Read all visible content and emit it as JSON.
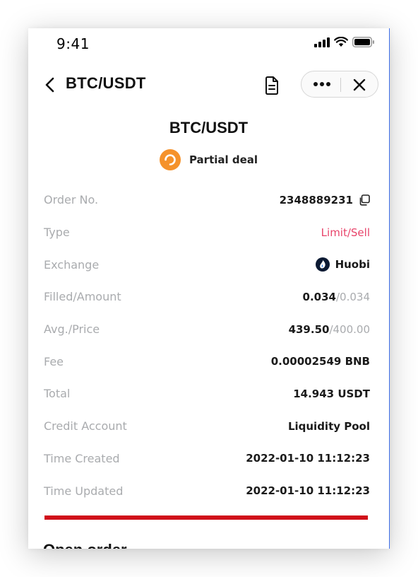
{
  "status_bar": {
    "time": "9:41"
  },
  "nav": {
    "title": "BTC/USDT"
  },
  "order": {
    "pair": "BTC/USDT",
    "status": "Partial deal",
    "status_color": "#f5922b",
    "rows": [
      {
        "label": "Order No.",
        "value": "2348889231"
      },
      {
        "label": "Type",
        "value": "Limit/Sell"
      },
      {
        "label": "Exchange",
        "value": "Huobi"
      },
      {
        "label": "Filled/Amount",
        "value": "0.034",
        "value_secondary": "/0.034"
      },
      {
        "label": "Avg./Price",
        "value": "439.50",
        "value_secondary": "/400.00"
      },
      {
        "label": "Fee",
        "value": "0.00002549 BNB"
      },
      {
        "label": "Total",
        "value": "14.943 USDT"
      },
      {
        "label": "Credit Account",
        "value": "Liquidity Pool"
      },
      {
        "label": "Time Created",
        "value": "2022-01-10 11:12:23"
      },
      {
        "label": "Time Updated",
        "value": "2022-01-10 11:12:23"
      }
    ]
  },
  "section": {
    "title": "Open order"
  },
  "colors": {
    "sell": "#e8436a",
    "label": "#a9abae",
    "divider_red": "#d0101a"
  }
}
